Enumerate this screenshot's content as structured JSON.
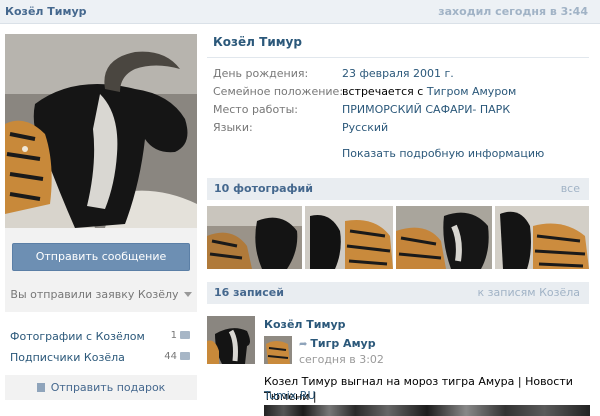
{
  "header": {
    "name": "Козёл Тимур",
    "online_status": "заходил сегодня в 3:44"
  },
  "actions": {
    "send_message": "Отправить сообщение",
    "request_status": "Вы отправили заявку Козёлу",
    "send_gift": "Отправить подарок"
  },
  "left_links": [
    {
      "label": "Фотографии с Козёлом",
      "count": "1"
    },
    {
      "label": "Подписчики Козёла",
      "count": "44"
    }
  ],
  "profile": {
    "name": "Козёл Тимур",
    "fields": [
      {
        "label": "День рождения:",
        "value": "23 февраля 2001 г."
      },
      {
        "label": "Семейное положение:",
        "value_prefix": "встречается с",
        "value_link": "Тигром Амуром"
      },
      {
        "label": "Место работы:",
        "value": "ПРИМОРСКИЙ САФАРИ- ПАРК"
      },
      {
        "label": "Языки:",
        "value": "Русский"
      }
    ],
    "show_more": "Показать подробную информацию"
  },
  "photos_section": {
    "title": "10 фотографий",
    "all_link": "все"
  },
  "wall_section": {
    "title": "16 записей",
    "link": "к записям Козёла"
  },
  "post": {
    "author": "Козёл Тимур",
    "repost_from": "Тигр Амур",
    "repost_time": "сегодня в 3:02",
    "text": "Козел Тимур выгнал на мороз тигра Амура | Новости Тюмени |",
    "link": "Tumix.RU"
  },
  "colors": {
    "accent": "#45688e",
    "link": "#2b587a",
    "button": "#6d8fb3",
    "header_bg": "#edf1f5"
  }
}
